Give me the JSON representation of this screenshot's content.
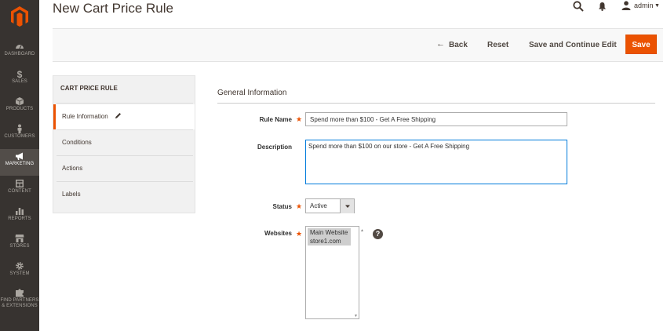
{
  "header": {
    "title": "New Cart Price Rule",
    "user": "admin"
  },
  "nav": [
    {
      "label": "DASHBOARD",
      "icon": "dashboard-icon"
    },
    {
      "label": "SALES",
      "icon": "dollar-icon"
    },
    {
      "label": "PRODUCTS",
      "icon": "box-icon"
    },
    {
      "label": "CUSTOMERS",
      "icon": "person-icon"
    },
    {
      "label": "MARKETING",
      "icon": "megaphone-icon",
      "active": true
    },
    {
      "label": "CONTENT",
      "icon": "content-icon"
    },
    {
      "label": "REPORTS",
      "icon": "bar-chart-icon"
    },
    {
      "label": "STORES",
      "icon": "store-icon"
    },
    {
      "label": "SYSTEM",
      "icon": "gear-icon"
    },
    {
      "label": "FIND PARTNERS",
      "label2": "& EXTENSIONS",
      "icon": "puzzle-icon"
    }
  ],
  "toolbar": {
    "back": "Back",
    "reset": "Reset",
    "save_continue": "Save and Continue Edit",
    "save": "Save"
  },
  "tabs": {
    "title": "CART PRICE RULE",
    "items": [
      "Rule Information",
      "Conditions",
      "Actions",
      "Labels"
    ]
  },
  "form": {
    "section_title": "General Information",
    "rule_name_label": "Rule Name",
    "rule_name_value": "Spend more than $100 - Get A Free Shipping",
    "description_label": "Description",
    "description_value": "Spend more than $100 on our store - Get A Free Shipping",
    "status_label": "Status",
    "status_value": "Active",
    "websites_label": "Websites",
    "websites_options": [
      "Main Website",
      "store1.com"
    ],
    "help_glyph": "?"
  },
  "colors": {
    "accent": "#eb5202",
    "sidebar": "#373330"
  }
}
